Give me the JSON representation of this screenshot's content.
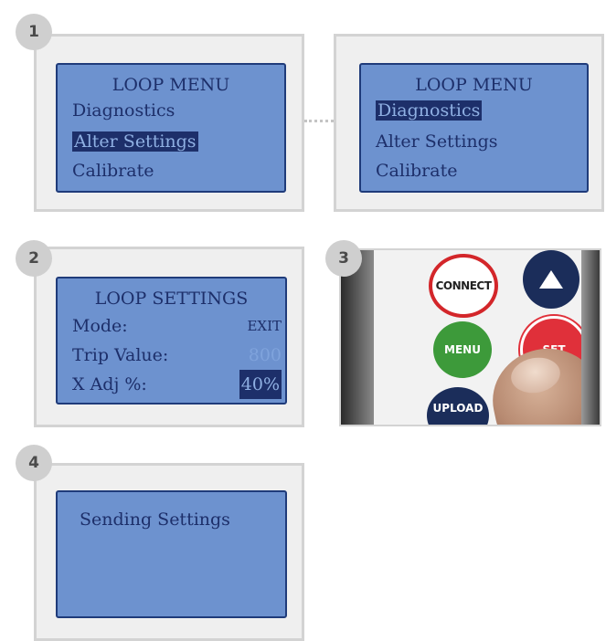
{
  "steps": {
    "one": {
      "badge": "1",
      "left_screen": {
        "title": "LOOP MENU",
        "items": [
          "Diagnostics",
          "Alter Settings",
          "Calibrate"
        ],
        "highlighted": "Alter Settings"
      },
      "right_screen": {
        "title": "LOOP MENU",
        "items": [
          "Diagnostics",
          "Alter Settings",
          "Calibrate"
        ],
        "highlighted": "Diagnostics"
      }
    },
    "two": {
      "badge": "2",
      "screen": {
        "title": "LOOP SETTINGS",
        "rows": [
          {
            "label": "Mode:",
            "value": "EXIT"
          },
          {
            "label": "Trip Value:",
            "value": "800"
          },
          {
            "label": "X Adj %:",
            "value": "40%"
          }
        ]
      }
    },
    "three": {
      "badge": "3",
      "buttons": {
        "connect": "CONNECT",
        "menu": "MENU",
        "set": "SET",
        "upload": "UPLOAD"
      },
      "icons": {
        "up": "up-arrow-icon"
      }
    },
    "four": {
      "badge": "4",
      "screen": {
        "message": "Sending Settings"
      }
    }
  },
  "colors": {
    "lcd_background": "#6d92cf",
    "lcd_text": "#1d2f6a",
    "panel_background": "#efefef",
    "panel_border": "#d3d3d3",
    "badge": "#cfcfcf"
  }
}
